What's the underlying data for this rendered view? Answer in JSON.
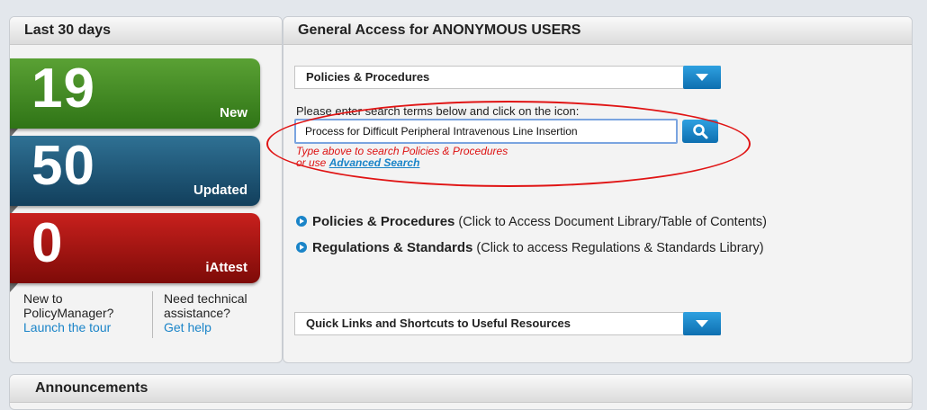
{
  "left": {
    "header": "Last 30 days",
    "tiles": [
      {
        "count": "19",
        "label": "New"
      },
      {
        "count": "50",
        "label": "Updated"
      },
      {
        "count": "0",
        "label": "iAttest"
      }
    ],
    "help_new": {
      "line1": "New to",
      "line2": "PolicyManager?",
      "link": "Launch the tour"
    },
    "help_tech": {
      "line1": "Need technical",
      "line2": "assistance?",
      "link": "Get help"
    }
  },
  "right": {
    "header": "General Access for ANONYMOUS USERS",
    "dropdown_top": "Policies & Procedures",
    "search": {
      "instruction": "Please enter search terms below and click on the icon:",
      "value": "Process for Difficult Peripheral Intravenous Line Insertion",
      "hint_line1": "Type above to search Policies & Procedures",
      "hint_line2_prefix": "or use ",
      "hint_link": "Advanced Search"
    },
    "links": [
      {
        "title": "Policies & Procedures",
        "desc": " (Click to Access Document Library/Table of Contents)"
      },
      {
        "title": "Regulations & Standards",
        "desc": " (Click to access Regulations & Standards Library)"
      }
    ],
    "dropdown_bottom": "Quick Links and Shortcuts to Useful Resources"
  },
  "announcements": {
    "header": "Announcements"
  },
  "colors": {
    "accent": "#1a84c8",
    "highlight": "#e01414",
    "new": "#3f8a20",
    "updated": "#1d5577",
    "iattest": "#a71410"
  }
}
